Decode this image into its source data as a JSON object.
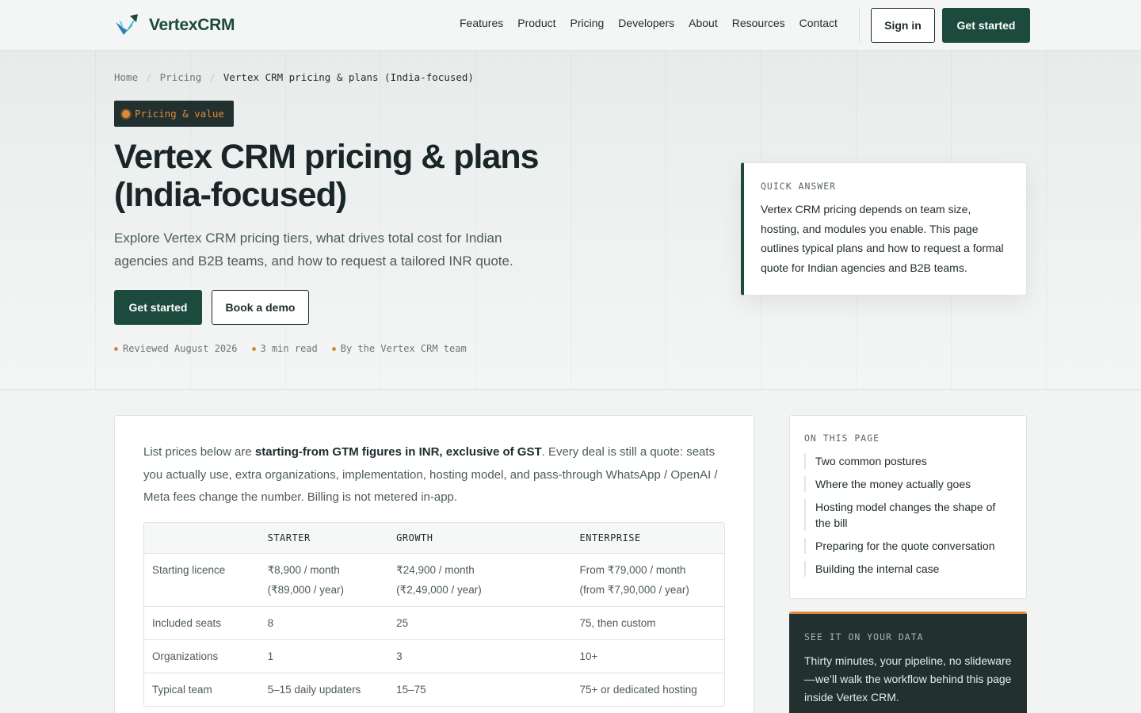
{
  "nav": {
    "brand": "VertexCRM",
    "links": [
      "Features",
      "Product",
      "Pricing",
      "Developers",
      "About",
      "Resources",
      "Contact"
    ],
    "sign_in": "Sign in",
    "get_started": "Get started"
  },
  "breadcrumb": [
    "Home",
    "Pricing",
    "Vertex CRM pricing & plans (India-focused)"
  ],
  "hero": {
    "badge": "Pricing & value",
    "title": "Vertex CRM pricing & plans (India-focused)",
    "subtitle": "Explore Vertex CRM pricing tiers, what drives total cost for Indian agencies and B2B teams, and how to request a tailored INR quote.",
    "cta_primary": "Get started",
    "cta_secondary": "Book a demo",
    "meta": [
      "Reviewed August 2026",
      "3 min read",
      "By the Vertex CRM team"
    ]
  },
  "quick_answer": {
    "label": "QUICK ANSWER",
    "text": "Vertex CRM pricing depends on team size, hosting, and modules you enable. This page outlines typical plans and how to request a formal quote for Indian agencies and B2B teams."
  },
  "intro": {
    "lead": "List prices below are ",
    "bold": "starting-from GTM figures in INR, exclusive of GST",
    "rest": ". Every deal is still a quote: seats you actually use, extra organizations, implementation, hosting model, and pass-through WhatsApp / OpenAI / Meta fees change the number. Billing is not metered in-app."
  },
  "pricing_table": {
    "headers": [
      "",
      "STARTER",
      "GROWTH",
      "ENTERPRISE"
    ],
    "licence": {
      "label": "Starting licence",
      "starter": [
        "₹8,900 / month",
        "(₹89,000 / year)"
      ],
      "growth": [
        "₹24,900 / month",
        "(₹2,49,000 / year)"
      ],
      "enterprise": [
        "From ₹79,000 / month",
        "(from ₹7,90,000 / year)"
      ]
    },
    "rows": [
      [
        "Included seats",
        "8",
        "25",
        "75, then custom"
      ],
      [
        "Organizations",
        "1",
        "3",
        "10+"
      ],
      [
        "Typical team",
        "5–15 daily updaters",
        "15–75",
        "75+ or dedicated hosting"
      ]
    ]
  },
  "toc": {
    "label": "ON THIS PAGE",
    "items": [
      "Two common postures",
      "Where the money actually goes",
      "Hosting model changes the shape of the bill",
      "Preparing for the quote conversation",
      "Building the internal case"
    ]
  },
  "demo": {
    "label": "SEE IT ON YOUR DATA",
    "text": "Thirty minutes, your pipeline, no slideware—we’ll walk the workflow behind this page inside Vertex CRM."
  },
  "colors": {
    "brand": "#1c4a3d",
    "accent": "#d98a3a",
    "dark": "#22302f"
  }
}
